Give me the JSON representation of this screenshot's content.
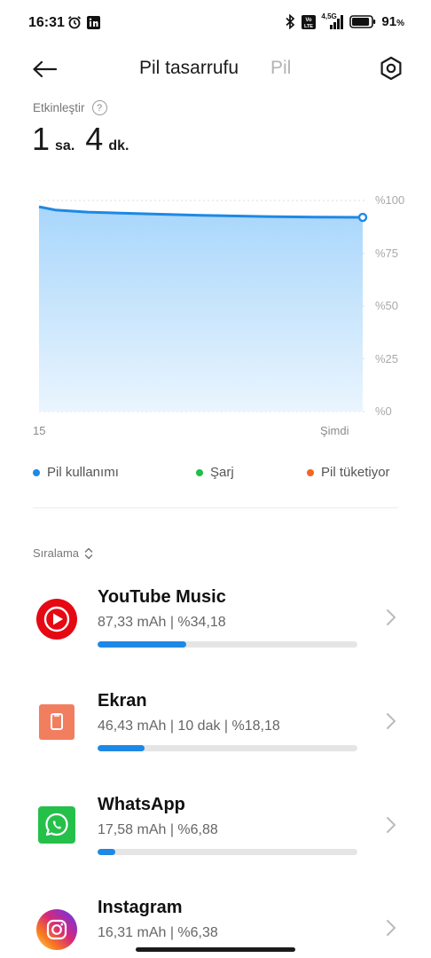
{
  "status_bar": {
    "time": "16:31",
    "network_label": "4,5G",
    "battery_percent": "91",
    "battery_sign": "%",
    "battery_level": 0.91
  },
  "header": {
    "active_tab": "Pil tasarrufu",
    "inactive_tab": "Pil"
  },
  "estimate": {
    "label": "Etkinleştir",
    "hours": "1",
    "hours_unit": "sa.",
    "minutes": "4",
    "minutes_unit": "dk."
  },
  "chart_data": {
    "type": "area",
    "x_labels": [
      "15",
      "Şimdi"
    ],
    "y_tick_labels": [
      "%100",
      "%75",
      "%50",
      "%25",
      "%0"
    ],
    "ylim": [
      0,
      100
    ],
    "series": [
      {
        "name": "Pil kullanımı",
        "points": [
          {
            "x": 0.0,
            "y": 97
          },
          {
            "x": 0.05,
            "y": 95.5
          },
          {
            "x": 0.15,
            "y": 94.5
          },
          {
            "x": 0.3,
            "y": 93.8
          },
          {
            "x": 0.5,
            "y": 93
          },
          {
            "x": 0.7,
            "y": 92.4
          },
          {
            "x": 0.85,
            "y": 92.1
          },
          {
            "x": 1.0,
            "y": 92
          }
        ]
      }
    ],
    "line_color": "#1e88e5",
    "fill_color_top": "#a8d6fb",
    "fill_color_bottom": "#eaf5fe",
    "grid": true
  },
  "legend": [
    {
      "label": "Pil kullanımı",
      "color": "#1e88e5"
    },
    {
      "label": "Şarj",
      "color": "#1fbf4a"
    },
    {
      "label": "Pil tüketiyor",
      "color": "#f26522"
    }
  ],
  "sort": {
    "label": "Sıralama"
  },
  "apps": [
    {
      "name": "YouTube Music",
      "detail": "87,33 mAh | %34,18",
      "usage_fraction": 0.3418,
      "icon": "youtube-music-icon",
      "icon_color": "#e50914"
    },
    {
      "name": "Ekran",
      "detail": "46,43 mAh | 10 dak  | %18,18",
      "usage_fraction": 0.1818,
      "icon": "screen-icon",
      "icon_color": "#f27e60"
    },
    {
      "name": "WhatsApp",
      "detail": "17,58 mAh | %6,88",
      "usage_fraction": 0.0688,
      "icon": "whatsapp-icon",
      "icon_color": "#25c04a"
    },
    {
      "name": "Instagram",
      "detail": "16,31 mAh | %6,38",
      "usage_fraction": 0.0638,
      "icon": "instagram-icon",
      "icon_color": "#d6249f"
    }
  ]
}
